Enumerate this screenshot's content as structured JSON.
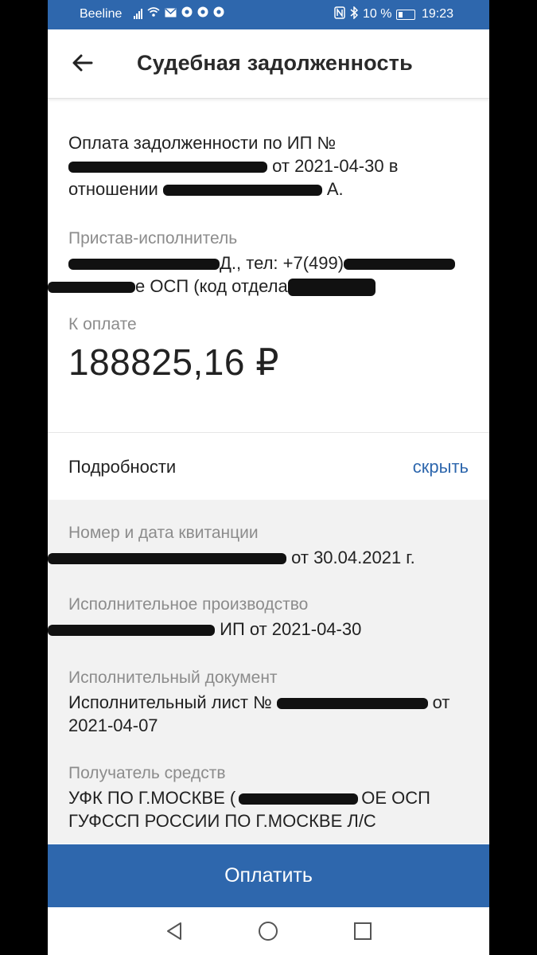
{
  "status_bar": {
    "carrier": "Beeline",
    "battery": "10 %",
    "time": "19:23",
    "icons": [
      "signal-icon",
      "wifi-icon",
      "mail-icon",
      "chrome-icon",
      "chrome-icon",
      "chrome-icon",
      "nfc-icon",
      "bluetooth-icon",
      "battery-icon"
    ]
  },
  "header": {
    "title": "Судебная задолженность"
  },
  "payment": {
    "description_line1": "Оплата задолженности по ИП №",
    "description_line2_suffix": "от 2021-04-30 в",
    "description_line3_prefix": "отношении",
    "description_line3_suffix": "А.",
    "bailiff_label": "Пристав-исполнитель",
    "bailiff_line1_mid": "Д., тел: +7(499)",
    "bailiff_line2_mid": "е ОСП (код отдела",
    "amount_label": "К оплате",
    "amount": "188825,16 ₽"
  },
  "details": {
    "label": "Подробности",
    "hide_label": "скрыть",
    "receipt_label": "Номер и дата квитанции",
    "receipt_suffix": "от 30.04.2021 г.",
    "enforcement_label": "Исполнительное производство",
    "enforcement_suffix": "ИП от 2021-04-30",
    "document_label": "Исполнительный документ",
    "document_prefix": "Исполнительный лист №",
    "document_suffix": "от",
    "document_line2": "2021-04-07",
    "recipient_label": "Получатель средств",
    "recipient_line1_prefix": "УФК ПО Г.МОСКВЕ (",
    "recipient_line1_suffix": "ОЕ ОСП",
    "recipient_line2": "ГУФССП РОССИИ ПО Г.МОСКВЕ Л/С"
  },
  "actions": {
    "pay_label": "Оплатить"
  },
  "colors": {
    "brand_blue": "#2e67ad",
    "label_gray": "#8c8c8c",
    "details_bg": "#f2f2f2"
  }
}
